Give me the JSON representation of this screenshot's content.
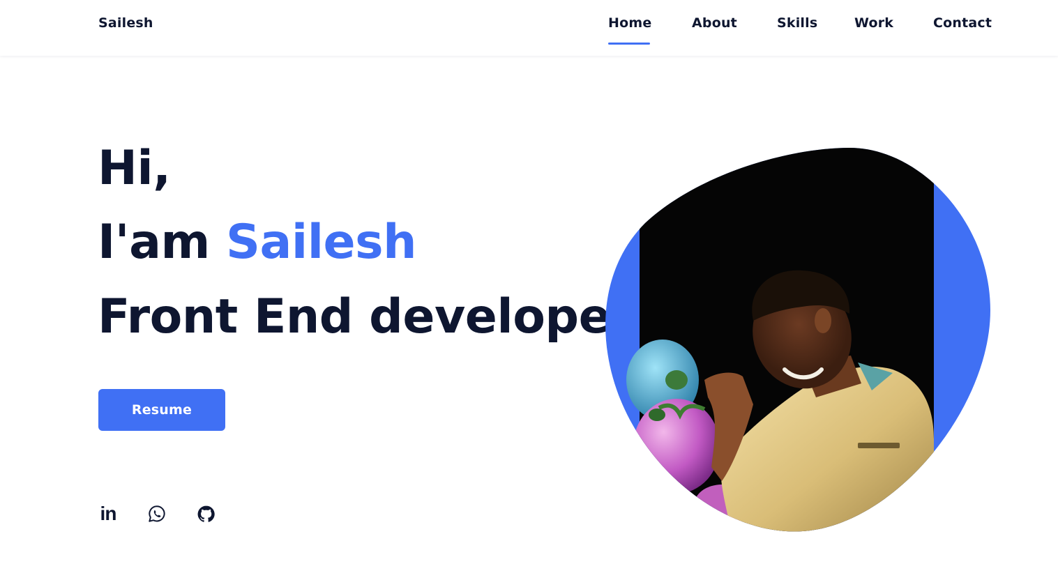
{
  "header": {
    "logo": "Sailesh",
    "nav": [
      {
        "label": "Home",
        "active": true
      },
      {
        "label": "About"
      },
      {
        "label": "Skills"
      },
      {
        "label": "Work"
      },
      {
        "label": "Contact"
      }
    ]
  },
  "hero": {
    "greeting": "Hi,",
    "intro_prefix": "I'am ",
    "name": "Sailesh",
    "role": "Front End developer",
    "resume_label": "Resume"
  },
  "social": [
    {
      "icon": "linkedin-icon",
      "glyph": "in"
    },
    {
      "icon": "whatsapp-icon"
    },
    {
      "icon": "github-icon"
    }
  ],
  "colors": {
    "accent": "#4070f4",
    "text_dark": "#0e1630",
    "photo_background": "#050505"
  }
}
